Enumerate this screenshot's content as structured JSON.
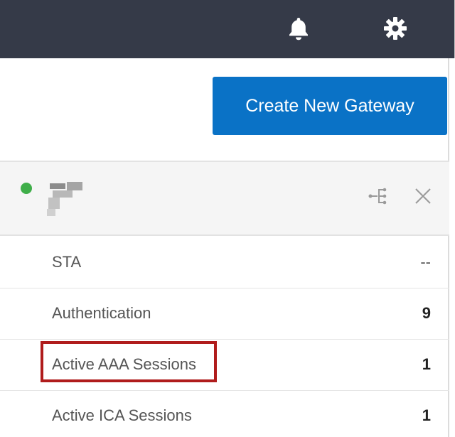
{
  "topbar": {
    "icons": [
      "bell-icon",
      "gear-icon"
    ],
    "background": "#353a48"
  },
  "actions": {
    "create_gateway_label": "Create New Gateway",
    "accent": "#0a72c6"
  },
  "gateway": {
    "status_color": "#3fae49",
    "icons": [
      "share-icon",
      "close-icon"
    ]
  },
  "stats": [
    {
      "label": "STA",
      "value": "--"
    },
    {
      "label": "Authentication",
      "value": "9"
    },
    {
      "label": "Active AAA Sessions",
      "value": "1"
    },
    {
      "label": "Active ICA Sessions",
      "value": "1"
    }
  ],
  "highlight_color": "#b01c1c"
}
